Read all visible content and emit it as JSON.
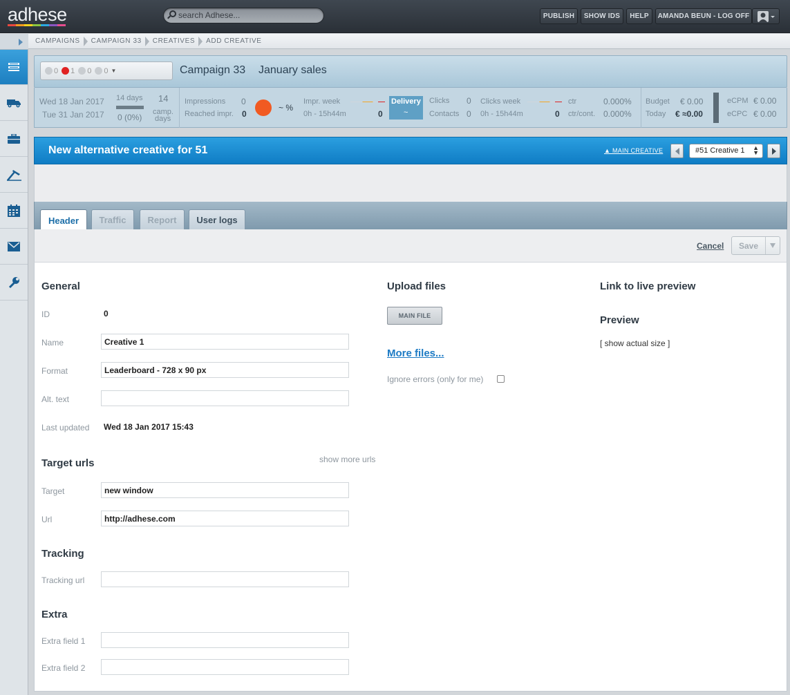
{
  "app": {
    "logo": "adhese",
    "logo_colors": [
      "#e8483f",
      "#f49a1e",
      "#f5d31c",
      "#8cc63f",
      "#2ba9e1",
      "#8a56c2",
      "#e64d8f"
    ]
  },
  "search": {
    "placeholder": "search Adhese..."
  },
  "topnav": {
    "publish": "PUBLISH",
    "show_ids": "SHOW IDS",
    "help": "HELP",
    "user": "AMANDA BEUN - LOG OFF"
  },
  "sidebar": {
    "icons": [
      "campaigns-icon",
      "truck-icon",
      "briefcase-icon",
      "tools-icon",
      "calendar-icon",
      "mail-icon",
      "wrench-icon"
    ],
    "active_index": 0,
    "accent": "#1d8fd6"
  },
  "breadcrumb": [
    "CAMPAIGNS",
    "CAMPAIGN 33",
    "CREATIVES",
    "ADD CREATIVE"
  ],
  "campaign": {
    "status_counts": [
      "0",
      "1",
      "0",
      "0"
    ],
    "title": "Campaign 33",
    "name": "January sales"
  },
  "stats": {
    "start_date": "Wed 18 Jan 2017",
    "end_date": "Tue 31 Jan 2017",
    "days_label": "14 days",
    "days_progress": "0 (0%)",
    "camp_days_value": "14",
    "camp_days_label1": "camp.",
    "camp_days_label2": "days",
    "impressions_label": "Impressions",
    "impressions_value": "0",
    "reached_label": "Reached impr.",
    "reached_value": "0",
    "percent": "~ %",
    "impr_week_label": "Impr. week",
    "impr_week_range": "0h - 15h44m",
    "impr_week_value": "0",
    "delivery_label": "Delivery",
    "delivery_value": "~",
    "clicks_label": "Clicks",
    "clicks_value": "0",
    "contacts_label": "Contacts",
    "contacts_value": "0",
    "clicks_week_label": "Clicks week",
    "clicks_week_range": "0h - 15h44m",
    "clicks_week_value": "0",
    "ctr_label": "ctr",
    "ctr_value": "0.000%",
    "ctr_cont_label": "ctr/cont.",
    "ctr_cont_value": "0.000%",
    "budget_label": "Budget",
    "budget_value": "€ 0.00",
    "today_label": "Today",
    "today_value": "€ ≈0.00",
    "ecpm_label": "eCPM",
    "ecpm_value": "€ 0.00",
    "ecpc_label": "eCPC",
    "ecpc_value": "€ 0.00",
    "delivery_indicator_color": "#f15a22"
  },
  "creative_bar": {
    "title": "New alternative creative for 51",
    "main_creative_link": "▲ MAIN CREATIVE",
    "selected": "#51 Creative 1"
  },
  "tabs": [
    "Header",
    "Traffic",
    "Report",
    "User logs"
  ],
  "actions": {
    "cancel": "Cancel",
    "save": "Save"
  },
  "form": {
    "general_title": "General",
    "id_label": "ID",
    "id_value": "0",
    "name_label": "Name",
    "name_value": "Creative 1",
    "format_label": "Format",
    "format_value": "Leaderboard - 728 x 90 px",
    "alt_label": "Alt. text",
    "alt_value": "",
    "updated_label": "Last updated",
    "updated_value": "Wed 18 Jan 2017 15:43",
    "target_urls_title": "Target urls",
    "show_more_urls": "show more urls",
    "target_label": "Target",
    "target_value": "new window",
    "url_label": "Url",
    "url_value": "http://adhese.com",
    "tracking_title": "Tracking",
    "tracking_label": "Tracking url",
    "tracking_value": "",
    "extra_title": "Extra",
    "extra1_label": "Extra field 1",
    "extra1_value": "",
    "extra2_label": "Extra field 2",
    "extra2_value": "",
    "upload_title": "Upload files",
    "main_file": "MAIN FILE",
    "more_files": "More files...",
    "ignore_errors": "Ignore errors (only for me)",
    "live_preview_title": "Link to live preview",
    "preview_title": "Preview",
    "show_actual_size": "[ show actual size ]"
  }
}
